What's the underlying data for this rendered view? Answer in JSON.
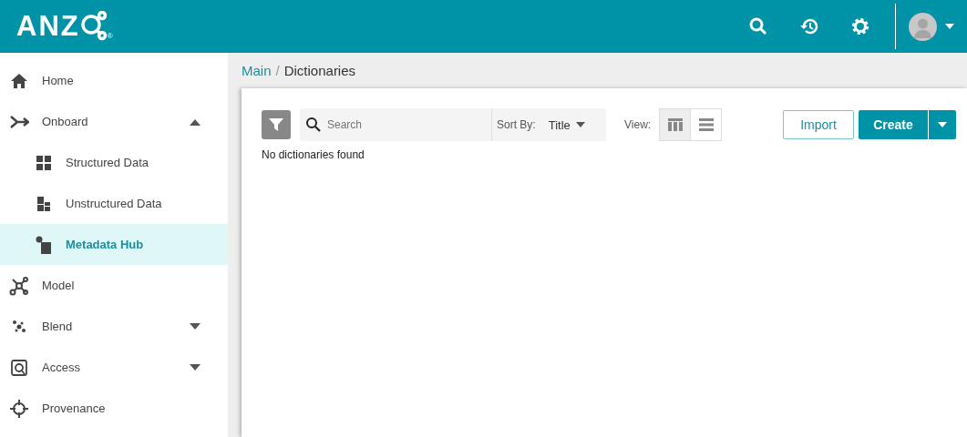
{
  "header": {
    "logo": "ANZ",
    "logo_mark": "®"
  },
  "sidebar": {
    "items": [
      {
        "label": "Home",
        "selected": false
      },
      {
        "label": "Onboard",
        "selected": false,
        "expanded": true,
        "children": [
          {
            "label": "Structured Data",
            "selected": false
          },
          {
            "label": "Unstructured Data",
            "selected": false
          },
          {
            "label": "Metadata Hub",
            "selected": true
          }
        ]
      },
      {
        "label": "Model",
        "selected": false
      },
      {
        "label": "Blend",
        "selected": false,
        "expanded": false
      },
      {
        "label": "Access",
        "selected": false,
        "expanded": false
      },
      {
        "label": "Provenance",
        "selected": false
      }
    ]
  },
  "breadcrumb": [
    "Main",
    "Dictionaries"
  ],
  "breadcrumb_separator": "/",
  "toolbar": {
    "search": {
      "placeholder": "Search"
    },
    "sort_label": "Sort By:",
    "sort_value": "Title",
    "view_label": "View:",
    "views": [
      {
        "kind": "table",
        "selected": true
      },
      {
        "kind": "list",
        "selected": false
      }
    ],
    "import": "Import",
    "create": "Create"
  },
  "empty_message": "No dictionaries found"
}
